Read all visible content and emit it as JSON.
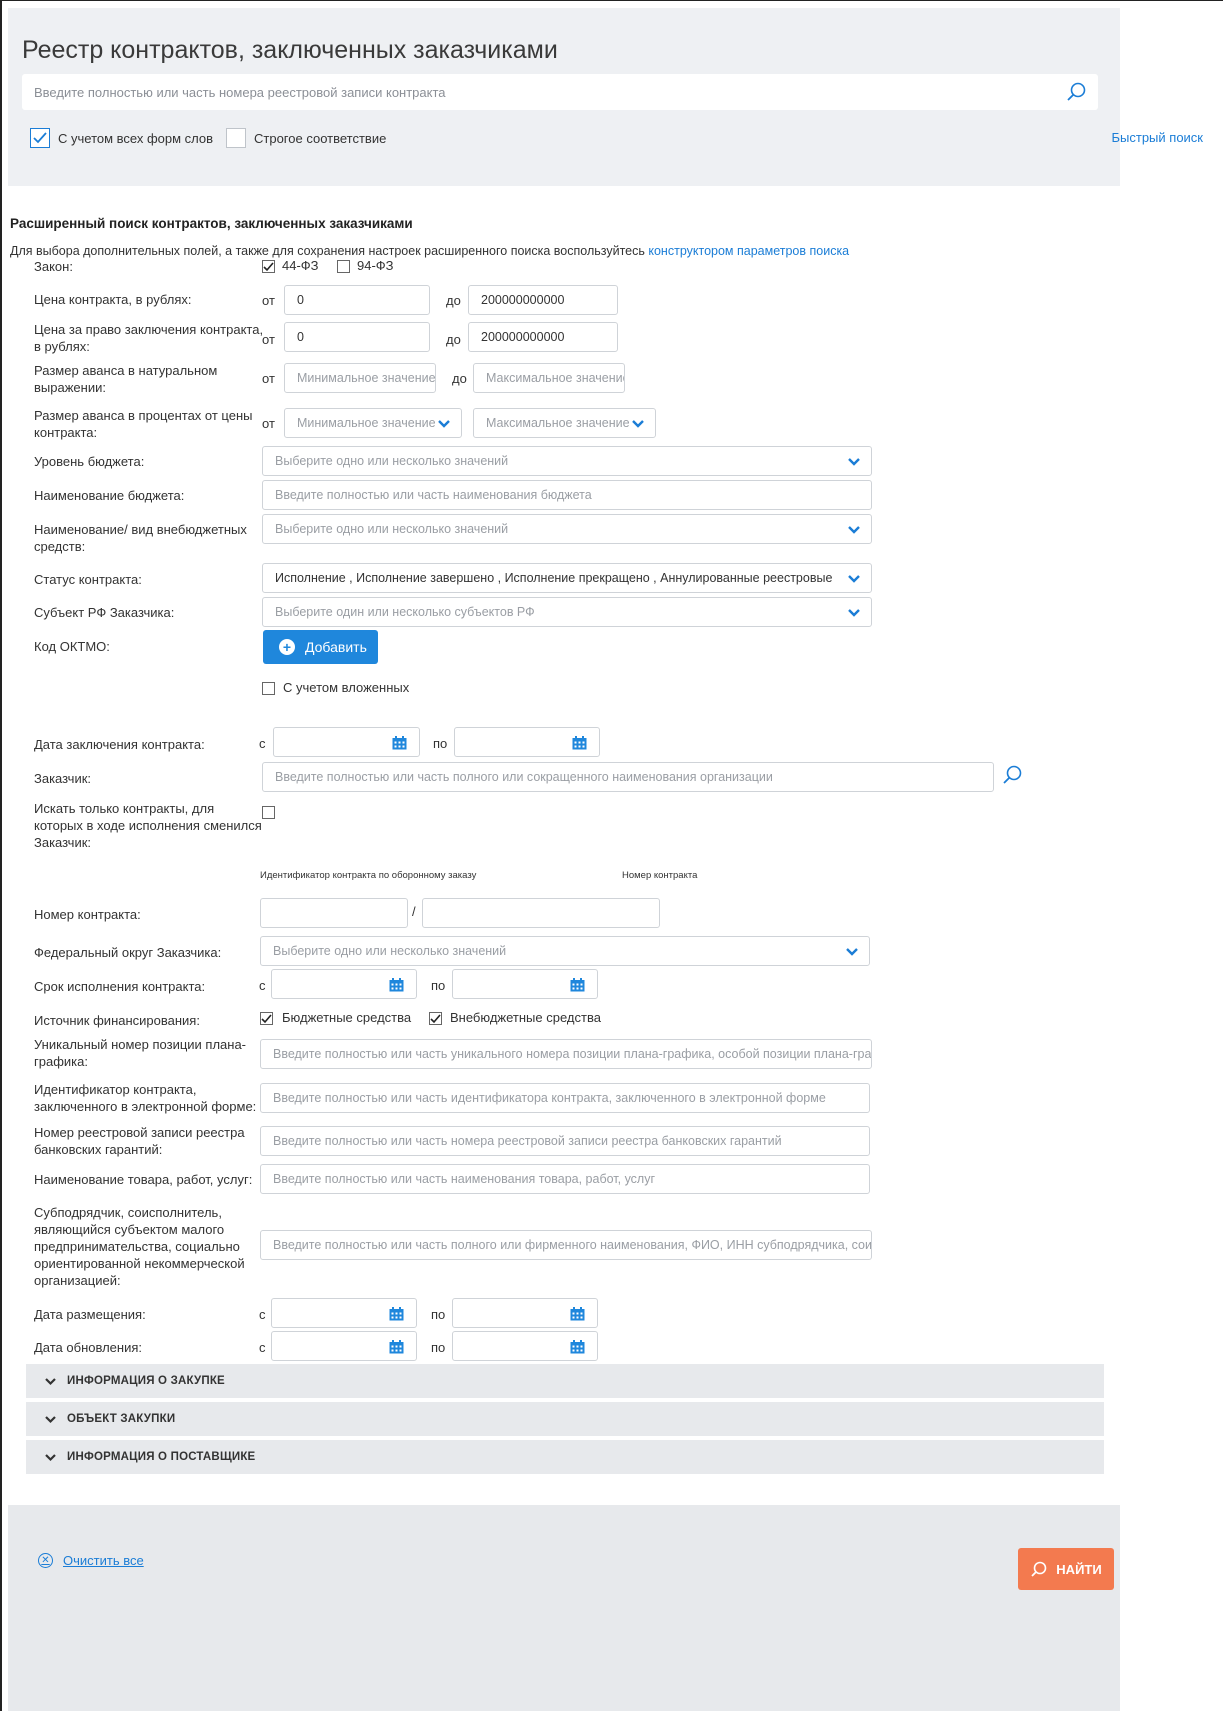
{
  "header": {
    "title": "Реестр контрактов, заключенных заказчиками",
    "search_placeholder": "Введите полностью или часть номера реестровой записи контракта",
    "all_word_forms_label": "С учетом всех форм слов",
    "all_word_forms_checked": true,
    "strict_match_label": "Строгое соответствие",
    "strict_match_checked": false,
    "quick_search_link": "Быстрый поиск"
  },
  "advanced": {
    "title": "Расширенный поиск контрактов, заключенных заказчиками",
    "note_prefix": "Для выбора дополнительных полей, а также для сохранения настроек расширенного поиска воспользуйтесь ",
    "note_link": "конструктором параметров поиска"
  },
  "fields": {
    "law": {
      "label": "Закон:",
      "opt1": "44-ФЗ",
      "opt1_checked": true,
      "opt2": "94-ФЗ",
      "opt2_checked": false
    },
    "price": {
      "label": "Цена контракта, в рублях:",
      "from": "от",
      "to": "до",
      "from_value": "0",
      "to_value": "200000000000"
    },
    "right_price": {
      "label": "Цена за право заключения контракта, в рублях:",
      "from": "от",
      "to": "до",
      "from_value": "0",
      "to_value": "200000000000"
    },
    "advance_natural": {
      "label": "Размер аванса в натуральном выражении:",
      "from": "от",
      "to": "до",
      "min_placeholder": "Минимальное значение",
      "max_placeholder": "Максимальное значение"
    },
    "advance_percent": {
      "label": "Размер аванса в процентах от цены контракта:",
      "from": "от",
      "min_placeholder": "Минимальное значение",
      "max_placeholder": "Максимальное значение"
    },
    "budget_level": {
      "label": "Уровень бюджета:",
      "placeholder": "Выберите одно или несколько значений"
    },
    "budget_name": {
      "label": "Наименование бюджета:",
      "placeholder": "Введите полностью или часть наименования бюджета"
    },
    "extrabudget": {
      "label": "Наименование/ вид внебюджетных средств:",
      "placeholder": "Выберите одно или несколько значений"
    },
    "status": {
      "label": "Статус контракта:",
      "value": "Исполнение , Исполнение завершено , Исполнение прекращено , Аннулированные реестровые"
    },
    "region": {
      "label": "Субъект РФ Заказчика:",
      "placeholder": "Выберите один или несколько субъектов РФ"
    },
    "oktmo": {
      "label": "Код ОКТМО:",
      "add_button": "Добавить",
      "nested_label": "С учетом вложенных"
    },
    "sign_date": {
      "label": "Дата заключения контракта:",
      "from": "с",
      "to": "по"
    },
    "customer": {
      "label": "Заказчик:",
      "placeholder": "Введите полностью или часть полного или сокращенного наименования организации"
    },
    "customer_changed": {
      "label": "Искать только контракты, для которых в ходе исполнения сменился Заказчик:"
    },
    "contract_number": {
      "label": "Номер контракта:",
      "hint_left": "Идентификатор контракта по оборонному заказу",
      "hint_right": "Номер контракта",
      "sep": "/"
    },
    "federal_district": {
      "label": "Федеральный округ Заказчика:",
      "placeholder": "Выберите одно или несколько значений"
    },
    "exec_date": {
      "label": "Срок исполнения контракта:",
      "from": "с",
      "to": "по"
    },
    "funding": {
      "label": "Источник финансирования:",
      "opt1": "Бюджетные средства",
      "opt1_checked": true,
      "opt2": "Внебюджетные средства",
      "opt2_checked": true
    },
    "plan_position": {
      "label": "Уникальный номер позиции плана-графика:",
      "placeholder": "Введите полностью или часть уникального номера позиции плана-графика, особой позиции плана-графика"
    },
    "electronic_id": {
      "label": "Идентификатор контракта, заключенного в электронной форме:",
      "placeholder": "Введите полностью или часть идентификатора контракта, заключенного в электронной форме"
    },
    "guarantee": {
      "label": "Номер реестровой записи реестра банковских гарантий:",
      "placeholder": "Введите полностью или часть номера реестровой записи реестра банковских гарантий"
    },
    "goods": {
      "label": "Наименование товара, работ, услуг:",
      "placeholder": "Введите полностью или часть наименования товара, работ, услуг"
    },
    "subcontractor": {
      "label": "Субподрядчик, соисполнитель, являющийся субъектом малого предпринимательства, социально ориентированной некоммерческой организацией:",
      "placeholder": "Введите полностью или часть полного или фирменного наименования, ФИО, ИНН субподрядчика, соисполни"
    },
    "publish_date": {
      "label": "Дата размещения:",
      "from": "с",
      "to": "по"
    },
    "update_date": {
      "label": "Дата обновления:",
      "from": "с",
      "to": "по"
    }
  },
  "accordions": [
    "ИНФОРМАЦИЯ О ЗАКУПКЕ",
    "ОБЪЕКТ ЗАКУПКИ",
    "ИНФОРМАЦИЯ О ПОСТАВЩИКЕ"
  ],
  "footer": {
    "clear_all": "Очистить все",
    "find_button": "НАЙТИ"
  },
  "colors": {
    "accent_blue": "#1b7dd6",
    "button_blue": "#1f87dc",
    "find_orange": "#f37a4f",
    "panel_gray": "#eef0f3"
  },
  "icons": {
    "search": "search-icon",
    "chevron": "chevron-down-icon",
    "calendar": "calendar-icon",
    "plus": "plus-circle-icon",
    "clear": "clear-circle-icon"
  }
}
